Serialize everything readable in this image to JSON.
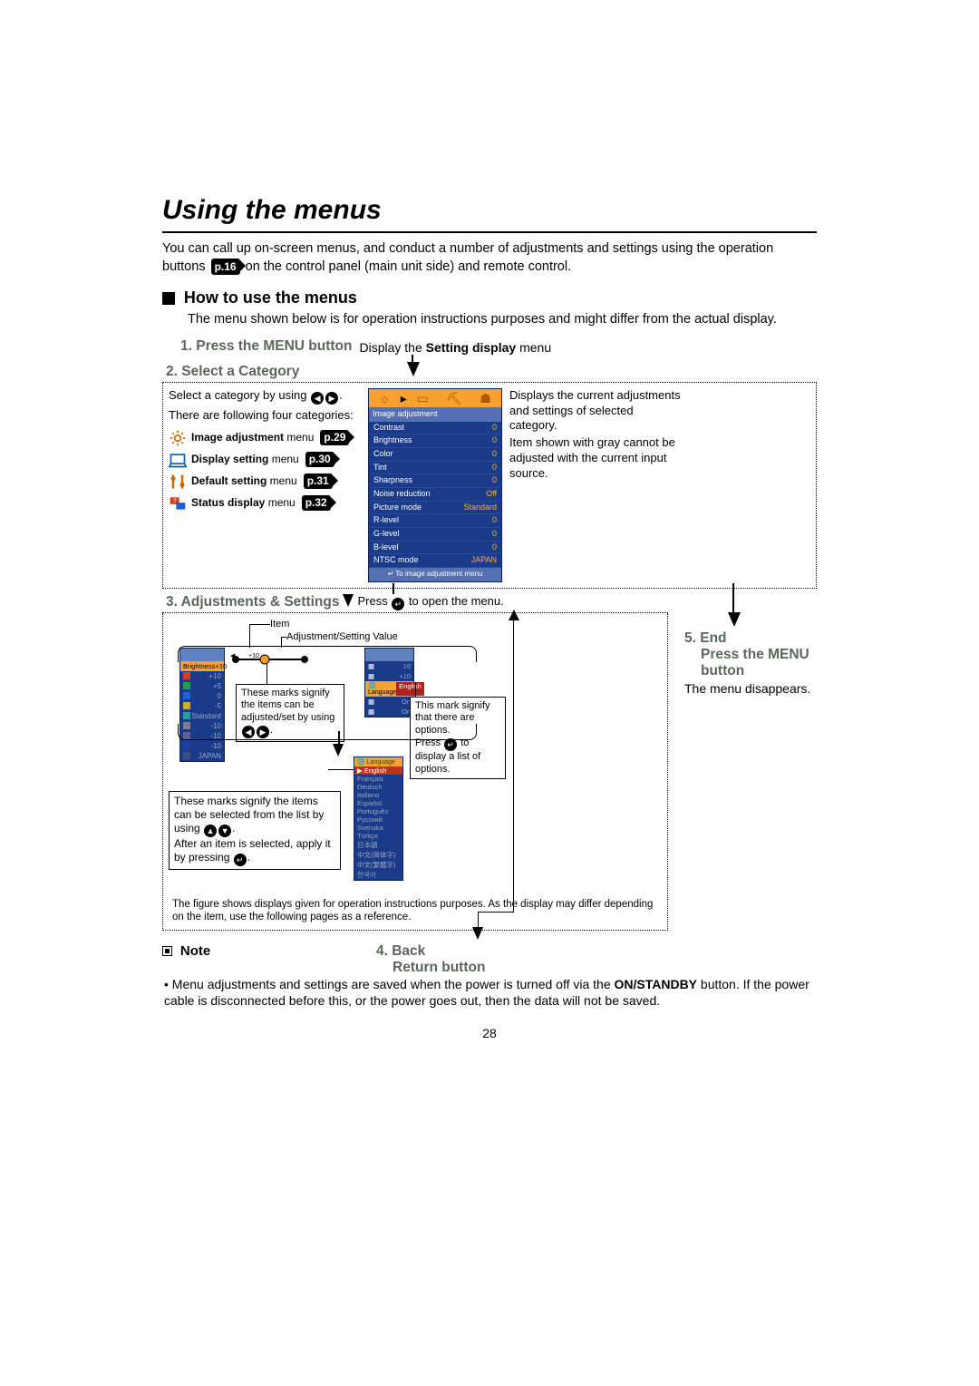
{
  "title": "Using the menus",
  "intro_a": "You can call up on-screen menus, and conduct a number of adjustments and settings using the operation buttons ",
  "intro_pref": "p.16",
  "intro_b": " on the control panel (main unit side) and remote control.",
  "howto": "How to use the menus",
  "howto_body": "The menu shown below is for operation instructions purposes and might differ from the actual display.",
  "step1": {
    "t": "1. Press the MENU button",
    "s1": "Display the ",
    "s2": "Setting display",
    "s3": " menu"
  },
  "step2": {
    "t": "2. Select a Category",
    "left_a": "Select a category by using ",
    "left_b": "There are following four categories:",
    "cats": [
      {
        "name": "Image adjustment",
        "suffix": " menu",
        "ref": "p.29"
      },
      {
        "name": "Display setting",
        "suffix": " menu",
        "ref": "p.30"
      },
      {
        "name": "Default setting",
        "suffix": " menu",
        "ref": "p.31"
      },
      {
        "name": "Status display",
        "suffix": " menu",
        "ref": "p.32"
      }
    ],
    "right_a": "Displays the current adjustments and settings of selected category.",
    "right_b": "Item shown with gray cannot be adjusted with the current input source."
  },
  "osd": {
    "hdr": "Image adjustment",
    "rows": [
      {
        "l": "Contrast",
        "v": "0"
      },
      {
        "l": "Brightness",
        "v": "0"
      },
      {
        "l": "Color",
        "v": "0"
      },
      {
        "l": "Tint",
        "v": "0"
      },
      {
        "l": "Sharpness",
        "v": "0"
      },
      {
        "l": "Noise reduction",
        "v": "Off"
      },
      {
        "l": "Picture mode",
        "v": "Standard"
      },
      {
        "l": "R-level",
        "v": "0"
      },
      {
        "l": "G-level",
        "v": "0"
      },
      {
        "l": "B-level",
        "v": "0"
      },
      {
        "l": "NTSC mode",
        "v": "JAPAN"
      }
    ],
    "foot": "To image adjustment menu"
  },
  "step3": {
    "t": "3. Adjustments & Settings",
    "press": "Press ",
    "press2": " to open the menu.",
    "lbl_item": "Item",
    "lbl_val": "Adjustment/Setting Value",
    "note1a": "These marks signify the items can be adjusted/set by using ",
    "note2a": "This mark signify that there are options.",
    "note2b": "Press ",
    "note2c": " to display a list of options.",
    "note3a": "These marks signify the items can be selected from the list by using ",
    "note3b": "After an item is selected, apply it by pressing ",
    "disclaimer": "The figure shows displays given for operation instructions purposes.  As the display may differ depending on the item, use the following pages as a reference."
  },
  "panel1": {
    "sel": {
      "l": "Brightness",
      "v": "+10"
    },
    "rows": [
      {
        "l": "",
        "v": "+10"
      },
      {
        "l": "",
        "v": "+5"
      },
      {
        "l": "",
        "v": "0"
      },
      {
        "l": "",
        "v": "-5"
      },
      {
        "l": "",
        "v": "Standard"
      },
      {
        "l": "",
        "v": "-10"
      },
      {
        "l": "",
        "v": "-10"
      },
      {
        "l": "",
        "v": "-10"
      },
      {
        "l": "",
        "v": "JAPAN"
      }
    ]
  },
  "panel2": {
    "rows": [
      {
        "l": "",
        "v": "16"
      },
      {
        "l": "",
        "v": "+10"
      }
    ],
    "sel": {
      "l": "Language",
      "v": "English"
    },
    "rows2": [
      {
        "l": "",
        "v": "On"
      },
      {
        "l": "",
        "v": "On"
      }
    ]
  },
  "panel3": {
    "hdr": "Language",
    "sel": "English",
    "rows": [
      "Français",
      "Deutsch",
      "Italiano",
      "Español",
      "Português",
      "Русский",
      "Svenska",
      "Türkçe",
      "日本語",
      "中文(简体字)",
      "中文(繁體字)",
      "한국어"
    ]
  },
  "step4": {
    "t": "4. Back",
    "s": "Return button"
  },
  "step5": {
    "t": "5. End",
    "s1": "Press the MENU button",
    "body": "The menu disappears."
  },
  "note": {
    "hdr": "Note",
    "a": "Menu adjustments and settings are saved when the power is turned off via the ",
    "b": "ON/STANDBY",
    "c": " button. If the power cable is disconnected before this, or the power goes out, then the data will not be saved."
  },
  "pagenum": "28"
}
